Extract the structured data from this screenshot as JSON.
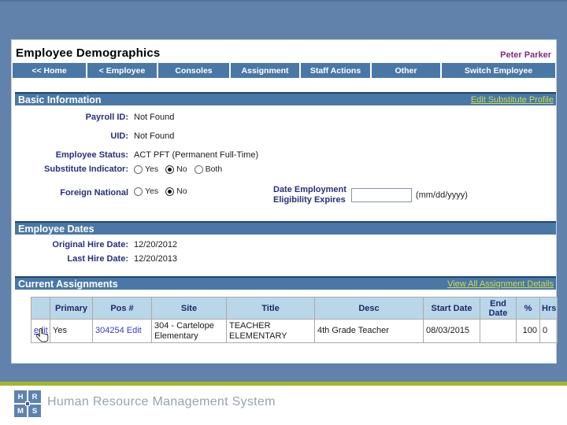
{
  "colors": {
    "frame_blue": "#6182ab",
    "bar_blue": "#4a78a6",
    "bar_top_navy": "#1d4275",
    "header_link_green": "#cddd4c",
    "table_header_bg": "#b9d7e9",
    "label_navy": "#262f7c",
    "link_blue": "#3a3ac8",
    "user_purple": "#822c7d",
    "accent_bar_green": "#a8b625",
    "logo_blue": "#5e82b0",
    "footer_text_gray": "#9aa2ac"
  },
  "header": {
    "title": "Employee Demographics",
    "user_name": "Peter Parker"
  },
  "nav": {
    "items": [
      "<< Home",
      "< Employee",
      "Consoles",
      "Assignment",
      "Staff Actions",
      "Other",
      "Switch Employee"
    ]
  },
  "basic_info": {
    "title": "Basic Information",
    "edit_link": "Edit Substitute Profile",
    "payroll_id": {
      "label": "Payroll ID:",
      "value": "Not Found"
    },
    "uid": {
      "label": "UID:",
      "value": "Not Found"
    },
    "employee_status": {
      "label": "Employee Status:",
      "value": "ACT PFT (Permanent Full-Time)"
    },
    "substitute_indicator": {
      "label": "Substitute Indicator:",
      "options": [
        "Yes",
        "No",
        "Both"
      ],
      "selected": "No"
    },
    "foreign_national": {
      "label": "Foreign National",
      "options": [
        "Yes",
        "No"
      ],
      "selected": "No"
    },
    "eligibility": {
      "label_line1": "Date Employment",
      "label_line2": "Eligibility Expires",
      "input_value": "",
      "format_hint": "(mm/dd/yyyy)"
    }
  },
  "employee_dates": {
    "title": "Employee Dates",
    "original_hire": {
      "label": "Original Hire Date:",
      "value": "12/20/2012"
    },
    "last_hire": {
      "label": "Last Hire Date:",
      "value": "12/20/2013"
    }
  },
  "current_assignments": {
    "title": "Current Assignments",
    "view_link": "View All Assignment Details",
    "table": {
      "headers": [
        "",
        "Primary",
        "Pos #",
        "Site",
        "Title",
        "Desc",
        "Start Date",
        "End Date",
        "%",
        "Hrs"
      ],
      "row": {
        "edit_link": "edit",
        "primary": "Yes",
        "pos_number": "304254",
        "pos_edit_link": "Edit",
        "site": "304 - Cartelope Elementary",
        "title": "TEACHER ELEMENTARY",
        "desc": "4th Grade Teacher",
        "start_date": "08/03/2015",
        "end_date": "",
        "percent": "100",
        "hrs": "0"
      }
    }
  },
  "footer": {
    "logo_letters": [
      "H",
      "R",
      "M",
      "S"
    ],
    "product_name": "Human Resource Management System"
  }
}
